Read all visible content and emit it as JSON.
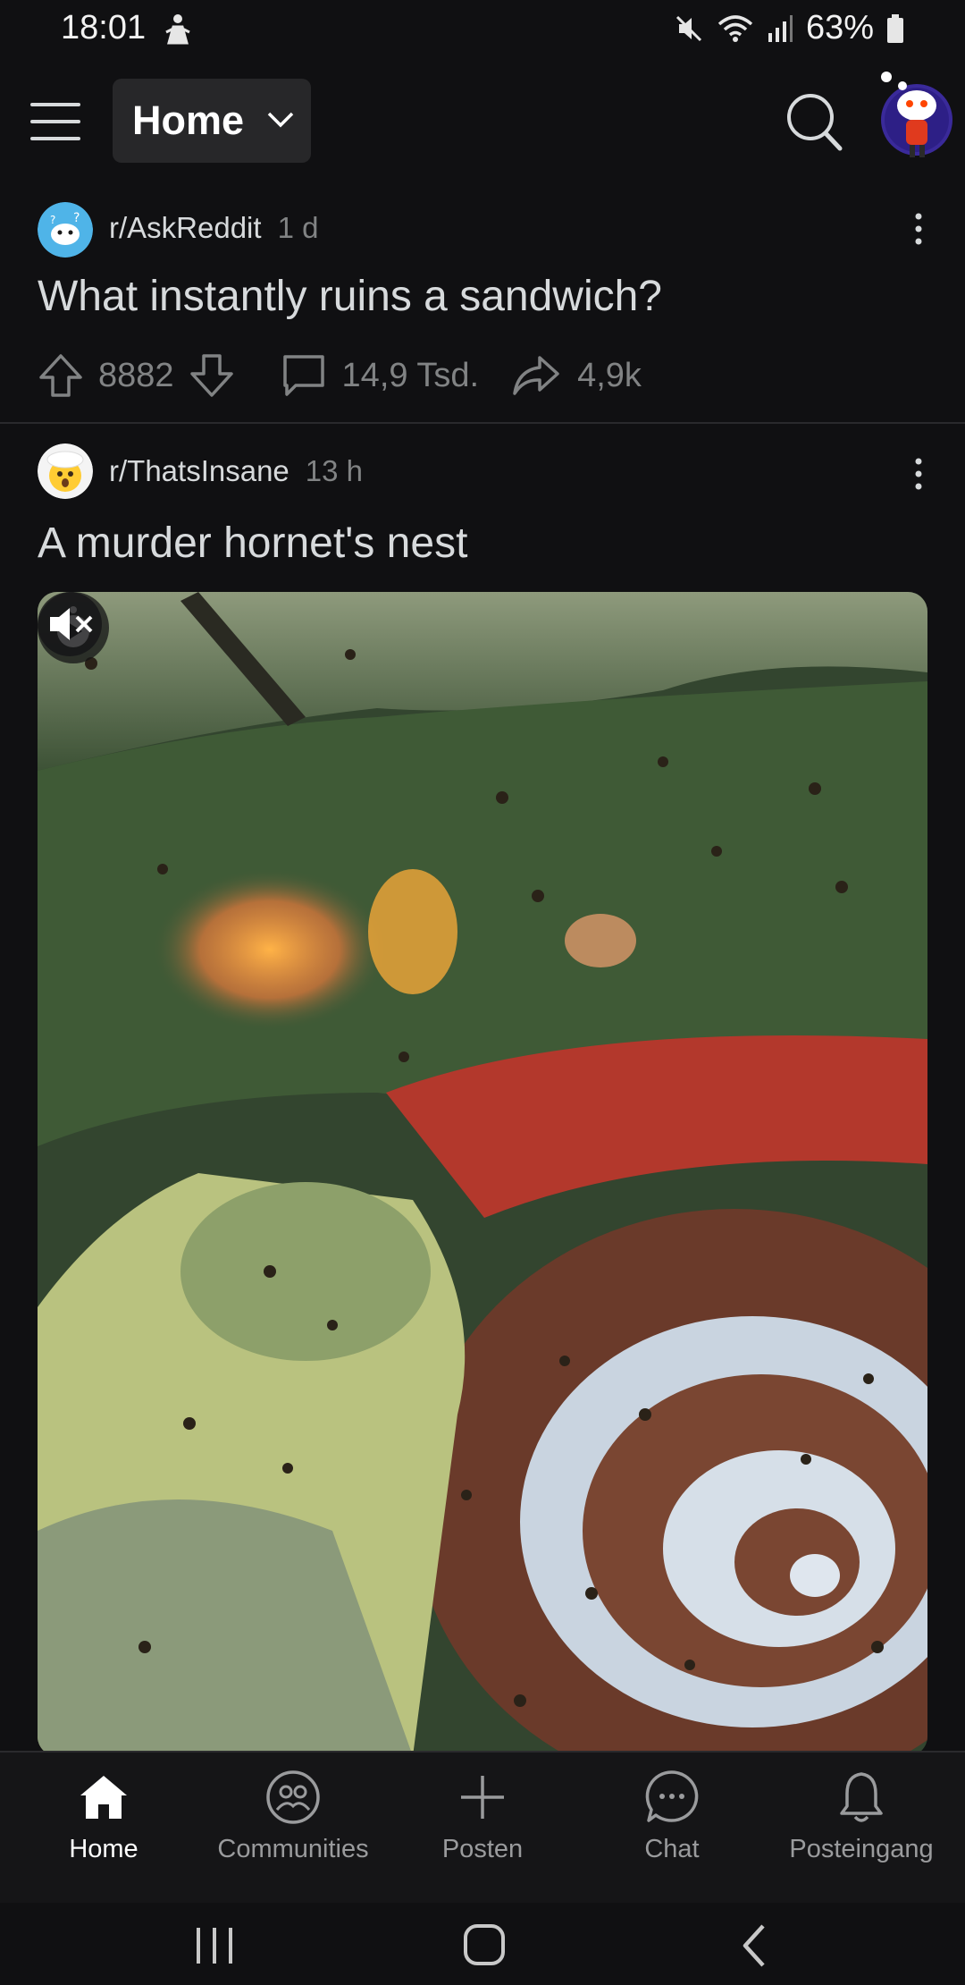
{
  "status_bar": {
    "time": "18:01",
    "battery": "63%",
    "icons": [
      "person-icon",
      "mute-icon",
      "wifi-icon",
      "signal-icon",
      "battery-icon"
    ]
  },
  "header": {
    "feed_label": "Home",
    "icons": [
      "menu-icon",
      "chevron-down-icon",
      "search-icon",
      "avatar"
    ]
  },
  "posts": [
    {
      "subreddit": "r/AskReddit",
      "age": "1 d",
      "title": "What instantly ruins a sandwich?",
      "votes": "8882",
      "comments": "14,9 Tsd.",
      "shares": "4,9k"
    },
    {
      "subreddit": "r/ThatsInsane",
      "age": "13 h",
      "title": "A murder hornet's nest",
      "media": "video"
    }
  ],
  "bottom_nav": {
    "items": [
      {
        "label": "Home",
        "icon": "home-icon",
        "active": true
      },
      {
        "label": "Communities",
        "icon": "communities-icon",
        "active": false
      },
      {
        "label": "Posten",
        "icon": "plus-icon",
        "active": false
      },
      {
        "label": "Chat",
        "icon": "chat-icon",
        "active": false
      },
      {
        "label": "Posteingang",
        "icon": "bell-icon",
        "active": false
      }
    ]
  },
  "system_nav": {
    "icons": [
      "recents-icon",
      "home-button-icon",
      "back-icon"
    ]
  },
  "colors": {
    "background": "#101012",
    "text": "#d7dadc",
    "muted": "#818384",
    "surface": "#272729"
  }
}
